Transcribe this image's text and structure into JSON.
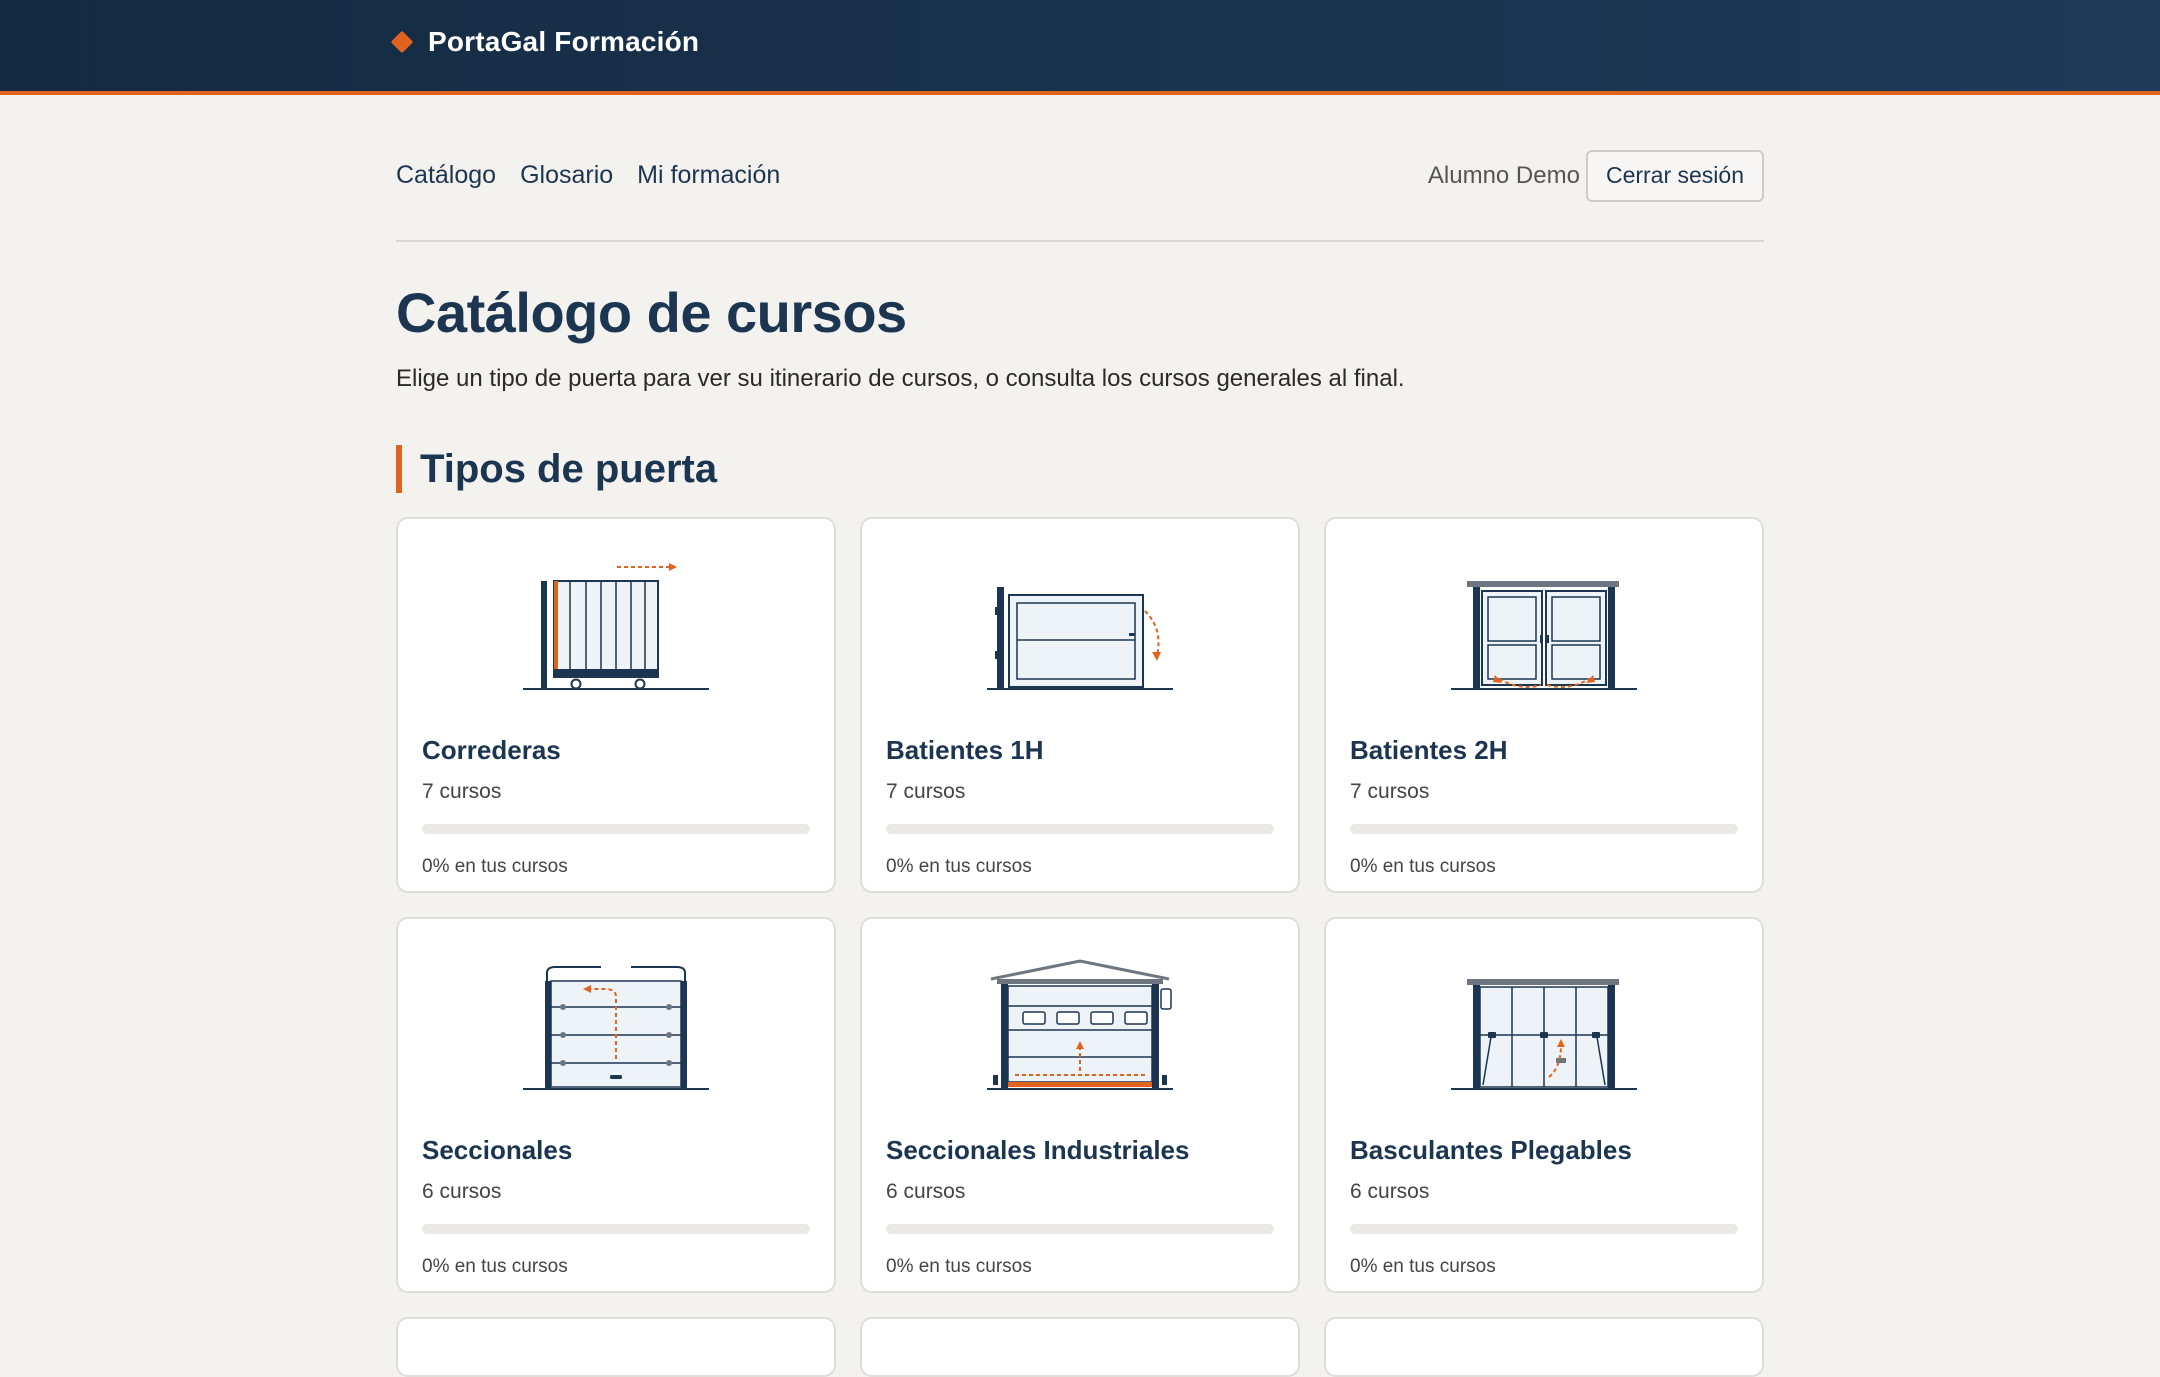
{
  "app": {
    "brand": "PortaGal Formación"
  },
  "nav": {
    "links": [
      "Catálogo",
      "Glosario",
      "Mi formación"
    ],
    "user_name": "Alumno Demo",
    "logout_label": "Cerrar sesión"
  },
  "page": {
    "title": "Catálogo de cursos",
    "subtitle": "Elige un tipo de puerta para ver su itinerario de cursos, o consulta los cursos generales al final."
  },
  "section": {
    "title": "Tipos de puerta"
  },
  "colors": {
    "accent": "#e0631e",
    "navy": "#1c3550",
    "background": "#f4f2ef"
  },
  "cards": [
    {
      "title": "Correderas",
      "count": "7 cursos",
      "progress_text": "0% en tus cursos",
      "progress": 0,
      "icon": "sliding-gate-icon"
    },
    {
      "title": "Batientes 1H",
      "count": "7 cursos",
      "progress_text": "0% en tus cursos",
      "progress": 0,
      "icon": "swing-gate-single-icon"
    },
    {
      "title": "Batientes 2H",
      "count": "7 cursos",
      "progress_text": "0% en tus cursos",
      "progress": 0,
      "icon": "swing-gate-double-icon"
    },
    {
      "title": "Seccionales",
      "count": "6 cursos",
      "progress_text": "0% en tus cursos",
      "progress": 0,
      "icon": "sectional-door-icon"
    },
    {
      "title": "Seccionales Industriales",
      "count": "6 cursos",
      "progress_text": "0% en tus cursos",
      "progress": 0,
      "icon": "industrial-sectional-door-icon"
    },
    {
      "title": "Basculantes Plegables",
      "count": "6 cursos",
      "progress_text": "0% en tus cursos",
      "progress": 0,
      "icon": "folding-tilt-door-icon"
    }
  ]
}
